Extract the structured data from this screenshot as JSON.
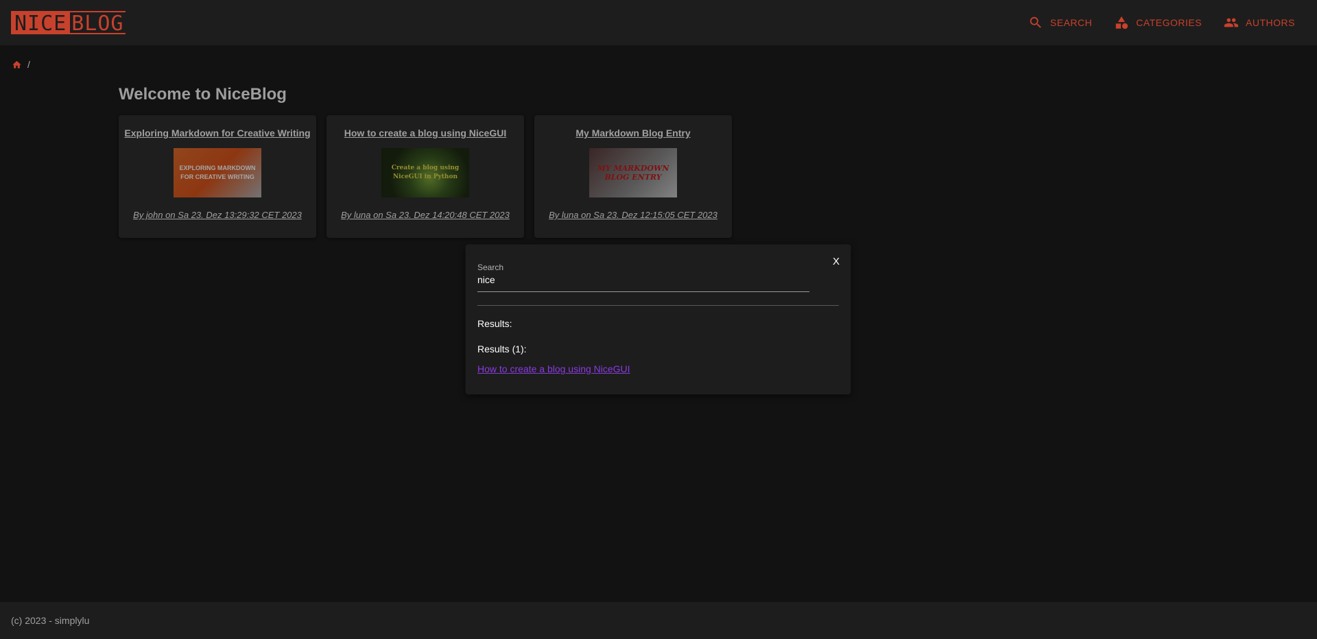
{
  "header": {
    "logo": {
      "part1": "NICE",
      "part2": "BLOG"
    },
    "nav": [
      {
        "label": "SEARCH",
        "icon": "search-icon"
      },
      {
        "label": "CATEGORIES",
        "icon": "category-icon"
      },
      {
        "label": "AUTHORS",
        "icon": "people-icon"
      }
    ]
  },
  "breadcrumb": {
    "icon": "home-icon",
    "separator": "/"
  },
  "main": {
    "title": "Welcome to NiceBlog",
    "cards": [
      {
        "title": "Exploring Markdown for Creative Writing",
        "thumb_text": [
          "EXPLORING MARKDOWN",
          "FOR CREATIVE WRITING"
        ],
        "meta": "By john on Sa 23. Dez 13:29:32 CET 2023"
      },
      {
        "title": "How to create a blog using NiceGUI",
        "thumb_text": [
          "Create a blog using",
          "NiceGUI in Python"
        ],
        "meta": "By luna on Sa 23. Dez 14:20:48 CET 2023"
      },
      {
        "title": "My Markdown Blog Entry",
        "thumb_text": [
          "MY MARKDOWN",
          "BLOG ENTRY"
        ],
        "meta": "By luna on Sa 23. Dez 12:15:05 CET 2023"
      }
    ]
  },
  "dialog": {
    "close_label": "X",
    "search_label": "Search",
    "search_value": "nice",
    "results_label": "Results:",
    "results_count_label": "Results (1):",
    "results": [
      "How to create a blog using NiceGUI"
    ]
  },
  "footer": {
    "text": "(c) 2023 - simplylu"
  },
  "colors": {
    "accent": "#c8412c",
    "link": "#8a3be0",
    "background": "#121212"
  }
}
